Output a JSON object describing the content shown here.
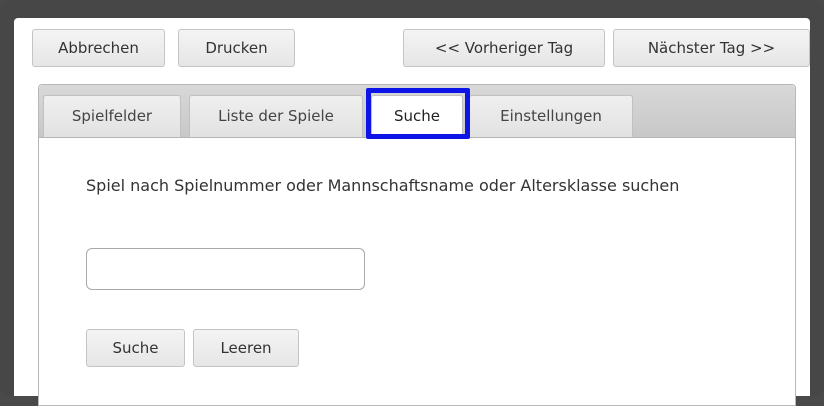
{
  "toolbar": {
    "cancel_label": "Abbrechen",
    "print_label": "Drucken",
    "prev_day_label": "<< Vorheriger Tag",
    "next_day_label": "Nächster Tag >>"
  },
  "tabs": [
    {
      "label": "Spielfelder",
      "active": false
    },
    {
      "label": "Liste der Spiele",
      "active": false
    },
    {
      "label": "Suche",
      "active": true
    },
    {
      "label": "Einstellungen",
      "active": false
    }
  ],
  "search": {
    "description": "Spiel nach Spielnummer oder Mannschaftsname oder Altersklasse suchen",
    "input_value": "",
    "search_label": "Suche",
    "clear_label": "Leeren"
  },
  "colors": {
    "highlight": "#0d14e8",
    "frame": "#474747"
  }
}
